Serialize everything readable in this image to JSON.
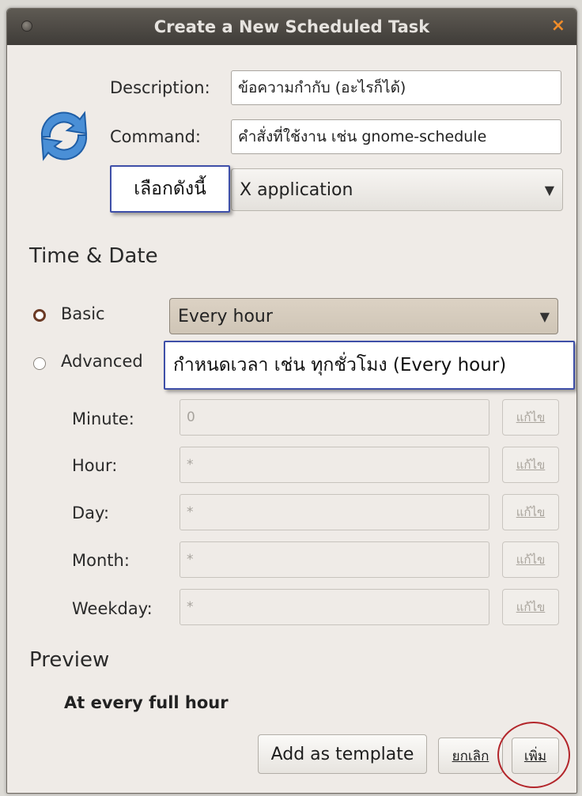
{
  "window": {
    "title": "Create a New Scheduled Task",
    "close_glyph": "×"
  },
  "form": {
    "description_label": "Description:",
    "description_value": "ข้อความกำกับ (อะไรก็ได้)",
    "command_label": "Command:",
    "command_value": "คำสั่งที่ใช้งาน เช่น gnome-schedule",
    "type_value": "X application",
    "icon": "refresh-icon"
  },
  "callouts": {
    "choose_like_this": "เลือกดังนี้",
    "set_time": "กำหนดเวลา เช่น ทุกชั่วโมง (Every hour)"
  },
  "time_date": {
    "heading": "Time & Date",
    "basic_label": "Basic",
    "advanced_label": "Advanced",
    "basic_selected": true,
    "basic_value": "Every hour",
    "rows": [
      {
        "label": "Minute:",
        "value": "0",
        "edit": "แก้ไข"
      },
      {
        "label": "Hour:",
        "value": "*",
        "edit": "แก้ไข"
      },
      {
        "label": "Day:",
        "value": "*",
        "edit": "แก้ไข"
      },
      {
        "label": "Month:",
        "value": "*",
        "edit": "แก้ไข"
      },
      {
        "label": "Weekday:",
        "value": "*",
        "edit": "แก้ไข"
      }
    ]
  },
  "preview": {
    "heading": "Preview",
    "text": "At every full hour"
  },
  "buttons": {
    "add_template": "Add as template",
    "cancel": "ยกเลิก",
    "add": "เพิ่ม"
  },
  "colors": {
    "callout_border": "#3e4fa8",
    "highlight_circle": "#b3262b",
    "close_accent": "#f08c2a"
  }
}
